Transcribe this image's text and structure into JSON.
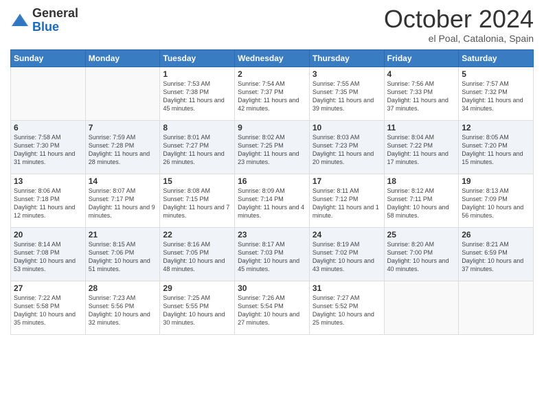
{
  "logo": {
    "general": "General",
    "blue": "Blue"
  },
  "header": {
    "month": "October 2024",
    "location": "el Poal, Catalonia, Spain"
  },
  "weekdays": [
    "Sunday",
    "Monday",
    "Tuesday",
    "Wednesday",
    "Thursday",
    "Friday",
    "Saturday"
  ],
  "weeks": [
    [
      {
        "day": "",
        "info": ""
      },
      {
        "day": "",
        "info": ""
      },
      {
        "day": "1",
        "info": "Sunrise: 7:53 AM\nSunset: 7:38 PM\nDaylight: 11 hours and 45 minutes."
      },
      {
        "day": "2",
        "info": "Sunrise: 7:54 AM\nSunset: 7:37 PM\nDaylight: 11 hours and 42 minutes."
      },
      {
        "day": "3",
        "info": "Sunrise: 7:55 AM\nSunset: 7:35 PM\nDaylight: 11 hours and 39 minutes."
      },
      {
        "day": "4",
        "info": "Sunrise: 7:56 AM\nSunset: 7:33 PM\nDaylight: 11 hours and 37 minutes."
      },
      {
        "day": "5",
        "info": "Sunrise: 7:57 AM\nSunset: 7:32 PM\nDaylight: 11 hours and 34 minutes."
      }
    ],
    [
      {
        "day": "6",
        "info": "Sunrise: 7:58 AM\nSunset: 7:30 PM\nDaylight: 11 hours and 31 minutes."
      },
      {
        "day": "7",
        "info": "Sunrise: 7:59 AM\nSunset: 7:28 PM\nDaylight: 11 hours and 28 minutes."
      },
      {
        "day": "8",
        "info": "Sunrise: 8:01 AM\nSunset: 7:27 PM\nDaylight: 11 hours and 26 minutes."
      },
      {
        "day": "9",
        "info": "Sunrise: 8:02 AM\nSunset: 7:25 PM\nDaylight: 11 hours and 23 minutes."
      },
      {
        "day": "10",
        "info": "Sunrise: 8:03 AM\nSunset: 7:23 PM\nDaylight: 11 hours and 20 minutes."
      },
      {
        "day": "11",
        "info": "Sunrise: 8:04 AM\nSunset: 7:22 PM\nDaylight: 11 hours and 17 minutes."
      },
      {
        "day": "12",
        "info": "Sunrise: 8:05 AM\nSunset: 7:20 PM\nDaylight: 11 hours and 15 minutes."
      }
    ],
    [
      {
        "day": "13",
        "info": "Sunrise: 8:06 AM\nSunset: 7:18 PM\nDaylight: 11 hours and 12 minutes."
      },
      {
        "day": "14",
        "info": "Sunrise: 8:07 AM\nSunset: 7:17 PM\nDaylight: 11 hours and 9 minutes."
      },
      {
        "day": "15",
        "info": "Sunrise: 8:08 AM\nSunset: 7:15 PM\nDaylight: 11 hours and 7 minutes."
      },
      {
        "day": "16",
        "info": "Sunrise: 8:09 AM\nSunset: 7:14 PM\nDaylight: 11 hours and 4 minutes."
      },
      {
        "day": "17",
        "info": "Sunrise: 8:11 AM\nSunset: 7:12 PM\nDaylight: 11 hours and 1 minute."
      },
      {
        "day": "18",
        "info": "Sunrise: 8:12 AM\nSunset: 7:11 PM\nDaylight: 10 hours and 58 minutes."
      },
      {
        "day": "19",
        "info": "Sunrise: 8:13 AM\nSunset: 7:09 PM\nDaylight: 10 hours and 56 minutes."
      }
    ],
    [
      {
        "day": "20",
        "info": "Sunrise: 8:14 AM\nSunset: 7:08 PM\nDaylight: 10 hours and 53 minutes."
      },
      {
        "day": "21",
        "info": "Sunrise: 8:15 AM\nSunset: 7:06 PM\nDaylight: 10 hours and 51 minutes."
      },
      {
        "day": "22",
        "info": "Sunrise: 8:16 AM\nSunset: 7:05 PM\nDaylight: 10 hours and 48 minutes."
      },
      {
        "day": "23",
        "info": "Sunrise: 8:17 AM\nSunset: 7:03 PM\nDaylight: 10 hours and 45 minutes."
      },
      {
        "day": "24",
        "info": "Sunrise: 8:19 AM\nSunset: 7:02 PM\nDaylight: 10 hours and 43 minutes."
      },
      {
        "day": "25",
        "info": "Sunrise: 8:20 AM\nSunset: 7:00 PM\nDaylight: 10 hours and 40 minutes."
      },
      {
        "day": "26",
        "info": "Sunrise: 8:21 AM\nSunset: 6:59 PM\nDaylight: 10 hours and 37 minutes."
      }
    ],
    [
      {
        "day": "27",
        "info": "Sunrise: 7:22 AM\nSunset: 5:58 PM\nDaylight: 10 hours and 35 minutes."
      },
      {
        "day": "28",
        "info": "Sunrise: 7:23 AM\nSunset: 5:56 PM\nDaylight: 10 hours and 32 minutes."
      },
      {
        "day": "29",
        "info": "Sunrise: 7:25 AM\nSunset: 5:55 PM\nDaylight: 10 hours and 30 minutes."
      },
      {
        "day": "30",
        "info": "Sunrise: 7:26 AM\nSunset: 5:54 PM\nDaylight: 10 hours and 27 minutes."
      },
      {
        "day": "31",
        "info": "Sunrise: 7:27 AM\nSunset: 5:52 PM\nDaylight: 10 hours and 25 minutes."
      },
      {
        "day": "",
        "info": ""
      },
      {
        "day": "",
        "info": ""
      }
    ]
  ]
}
